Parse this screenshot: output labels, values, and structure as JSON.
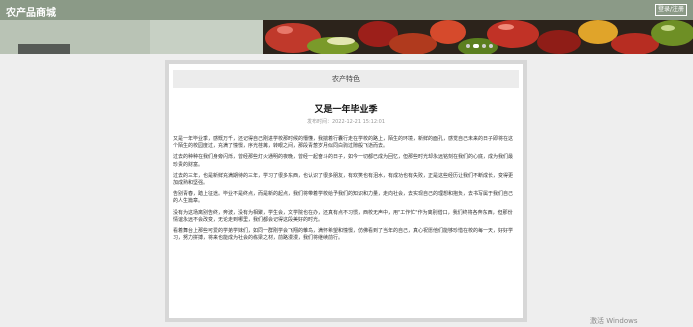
{
  "header": {
    "site_title": "农产品商城",
    "login_label": "登录/注册"
  },
  "colors": {
    "header_bg": "#8b9a87",
    "page_bg": "#eeeeee",
    "panel_border": "#d7d7d7"
  },
  "banner": {
    "slides": 4,
    "active_slide": 1
  },
  "section": {
    "label": "农产特色"
  },
  "article": {
    "title": "又是一年毕业季",
    "meta": "发布时间：2022-12-21 15:12:01",
    "paragraphs": [
      "又是一年毕业季，感慨万千，还记得自己刚进学校那时候的懵懂，我揣着行囊行走在学校的路上，陌生的环境，新鲜的面孔，感觉自己未来的日子即将在这个陌生的校园度过，充满了憧憬，序光荏苒，转眼之间，那段青葱岁月似同白驹过隙般飞逝而去。",
      "过去的种种在我们身旁闪烁，曾经那些灯火通明的夜晚，曾经一起奋斗的日子，如今一切都已成为回忆，但那些时光却永远铭刻在我们的心底，成为我们最珍贵的财富。",
      "过去的三年，也是新鲜充满期待的三年，学习了很多东西，也认识了很多朋友，有欢笑也有泪水，有成功也有失败，正是这些经历让我们不断成长，变得更加成熟和坚强。",
      "告别青春，踏上征途。毕业不是终点，而是新的起点，我们将带着学校给予我们的知识和力量，走向社会，去实现自己的理想和抱负，去书写属于我们自己的人生篇章。",
      "没有为这场离别告终，奔波，没有为相聚，学生会，文学院也在办，还真有点不习惯，西校无声中，用\"工作忙\"作为离别借口，我们终将各奔东西，但那份情谊永远不会改变，无论走到哪里，我们都会记得这段美好的时光。",
      "看着舞台上那些可爱的学弟学妹们，如同一群刚学会飞翔的雏鸟，满怀希望和憧憬，仿佛看到了当年的自己，真心祝愿他们能够珍惜在校的每一天，好好学习，努力拼搏，将来也能成为社会的栋梁之材，前路漫漫，我们将继续前行。"
    ]
  },
  "watermark": "激活 Windows"
}
